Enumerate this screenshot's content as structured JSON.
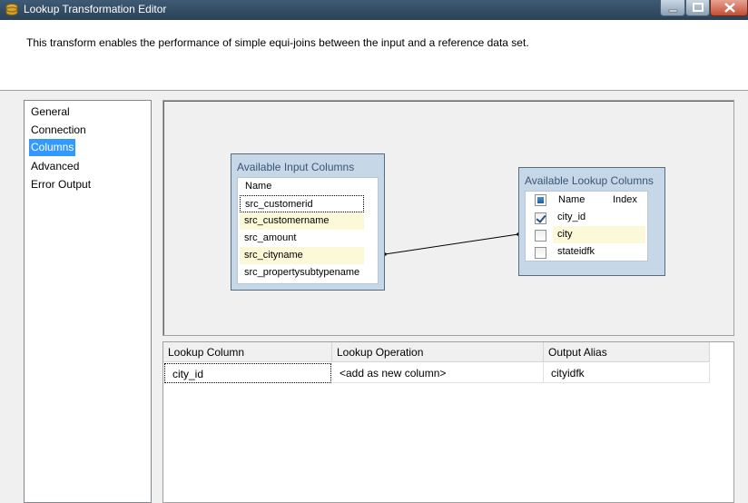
{
  "window": {
    "title": "Lookup Transformation Editor"
  },
  "description": "This transform enables the performance of simple equi-joins between the input and a reference data set.",
  "nav": {
    "items": [
      {
        "label": "General",
        "selected": false
      },
      {
        "label": "Connection",
        "selected": false
      },
      {
        "label": "Columns",
        "selected": true
      },
      {
        "label": "Advanced",
        "selected": false
      },
      {
        "label": "Error Output",
        "selected": false
      }
    ]
  },
  "input_columns": {
    "title": "Available Input Columns",
    "header": "Name",
    "rows": [
      "src_customerid",
      "src_customername",
      "src_amount",
      "src_cityname",
      "src_propertysubtypename"
    ]
  },
  "lookup_columns": {
    "title": "Available Lookup Columns",
    "header_name": "Name",
    "header_index": "Index",
    "rows": [
      {
        "name": "city_id",
        "checked": true
      },
      {
        "name": "city",
        "checked": false
      },
      {
        "name": "stateidfk",
        "checked": false
      }
    ]
  },
  "mapping_grid": {
    "headers": [
      "Lookup Column",
      "Lookup Operation",
      "Output Alias"
    ],
    "rows": [
      [
        "city_id",
        "<add as new column>",
        "cityidfk"
      ]
    ]
  },
  "colors": {
    "selection": "#3399ff",
    "box_fill": "#c6d7e8",
    "alt_row": "#fbf9d7"
  }
}
